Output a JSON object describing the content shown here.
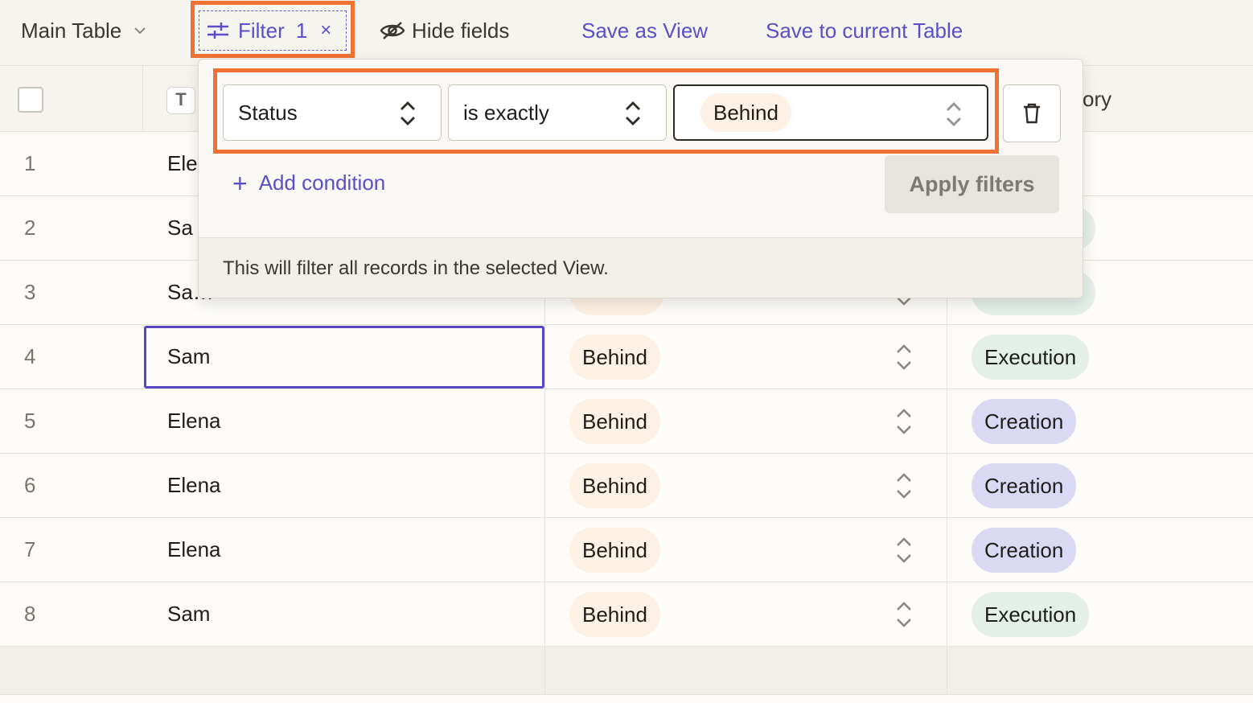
{
  "toolbar": {
    "view_name": "Main Table",
    "filter_label": "Filter",
    "filter_count": "1",
    "filter_clear": "×",
    "hide_fields": "Hide fields",
    "save_as_view": "Save as View",
    "save_to_current": "Save to current Table"
  },
  "header": {
    "type_icon": "T",
    "category_fragment": "ory"
  },
  "filter_popover": {
    "condition": {
      "field": "Status",
      "operator": "is exactly",
      "value": "Behind"
    },
    "add_condition": "Add condition",
    "apply": "Apply filters",
    "footer_note": "This will filter all records in the selected View."
  },
  "rows": [
    {
      "num": "1",
      "name": "Ele",
      "status": "",
      "category": ""
    },
    {
      "num": "2",
      "name": "Sa",
      "status": "",
      "category": ""
    },
    {
      "num": "3",
      "name": "Sa…",
      "status": "",
      "category": ""
    },
    {
      "num": "4",
      "name": "Sam",
      "status": "Behind",
      "category": "Execution"
    },
    {
      "num": "5",
      "name": "Elena",
      "status": "Behind",
      "category": "Creation"
    },
    {
      "num": "6",
      "name": "Elena",
      "status": "Behind",
      "category": "Creation"
    },
    {
      "num": "7",
      "name": "Elena",
      "status": "Behind",
      "category": "Creation"
    },
    {
      "num": "8",
      "name": "Sam",
      "status": "Behind",
      "category": "Execution"
    }
  ],
  "colors": {
    "accent": "#5b4fc8",
    "highlight": "#f07132",
    "status_behind": "#fdf0e4",
    "category_execution": "#e3efe8",
    "category_creation": "#d9d9f4"
  }
}
